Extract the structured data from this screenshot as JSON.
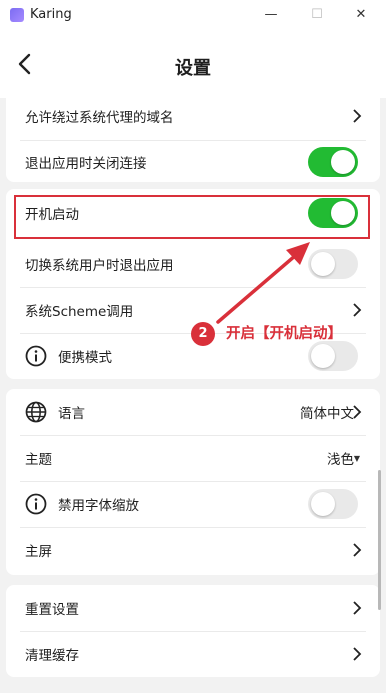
{
  "window": {
    "app_title": "Karing",
    "minimize_glyph": "—",
    "maximize_glyph": "☐",
    "close_glyph": "✕"
  },
  "header": {
    "title": "设置"
  },
  "settings": {
    "group1": {
      "bypass_domains": "允许绕过系统代理的域名",
      "disconnect_on_exit": "退出应用时关闭连接",
      "disconnect_on_exit_on": true
    },
    "group2": {
      "launch_at_startup": "开机启动",
      "launch_at_startup_on": true,
      "exit_on_user_switch": "切换系统用户时退出应用",
      "exit_on_user_switch_on": false,
      "scheme_call": "系统Scheme调用",
      "portable_mode": "便携模式",
      "portable_mode_on": false
    },
    "group3": {
      "language": "语言",
      "language_value": "简体中文",
      "theme": "主题",
      "theme_value": "浅色",
      "disable_font_scaling": "禁用字体缩放",
      "disable_font_scaling_on": false,
      "home_screen": "主屏"
    },
    "group4": {
      "reset_settings": "重置设置",
      "clear_cache": "清理缓存"
    }
  },
  "annotation": {
    "step_number": "2",
    "text": "开启【开机启动】",
    "color": "#d9303a"
  },
  "colors": {
    "toggle_on": "#22bb33",
    "toggle_off": "#e9e9e9",
    "background": "#f2f2f2"
  },
  "icons": {
    "back": "chevron-left-icon",
    "chevron": "chevron-right-icon",
    "info": "info-icon",
    "globe": "globe-icon"
  }
}
